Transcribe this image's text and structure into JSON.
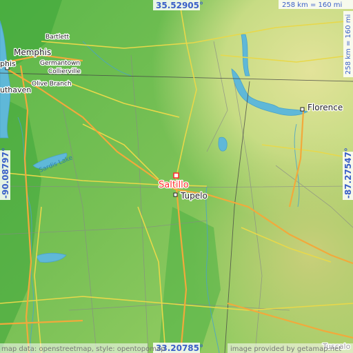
{
  "map": {
    "focus_place": "Saltillo",
    "places": {
      "memphis": "Memphis",
      "bartlett": "Bartlett",
      "germantown": "Germantown",
      "collierville": "Collierville",
      "olive_branch": "Olive Branch",
      "southaven_partial": "uthaven",
      "memphis_partial": "phis",
      "florence": "Florence",
      "tupelo": "Tupelo",
      "tuscaloosa_partial": "Tuscalo"
    },
    "water_labels": {
      "sardis_lake": "Sardis Lake"
    },
    "coordinates": {
      "top": "35.52905°",
      "bottom": "33.20785°",
      "left": "-90.08797°",
      "right": "-87.27547°"
    },
    "scale": {
      "top": "258 km = 160 mi",
      "right": "258 km = 160 mi"
    },
    "credits": {
      "left": "map data: openstreetmap, style: opentopomap",
      "right": "image provided by getamap.net"
    },
    "colors": {
      "focus_marker": "#ff3030",
      "coordinate_text": "#3a5fc8",
      "water": "#5fb8d8",
      "road_major": "#f2a93b",
      "road_minor": "#e8d84a"
    }
  }
}
